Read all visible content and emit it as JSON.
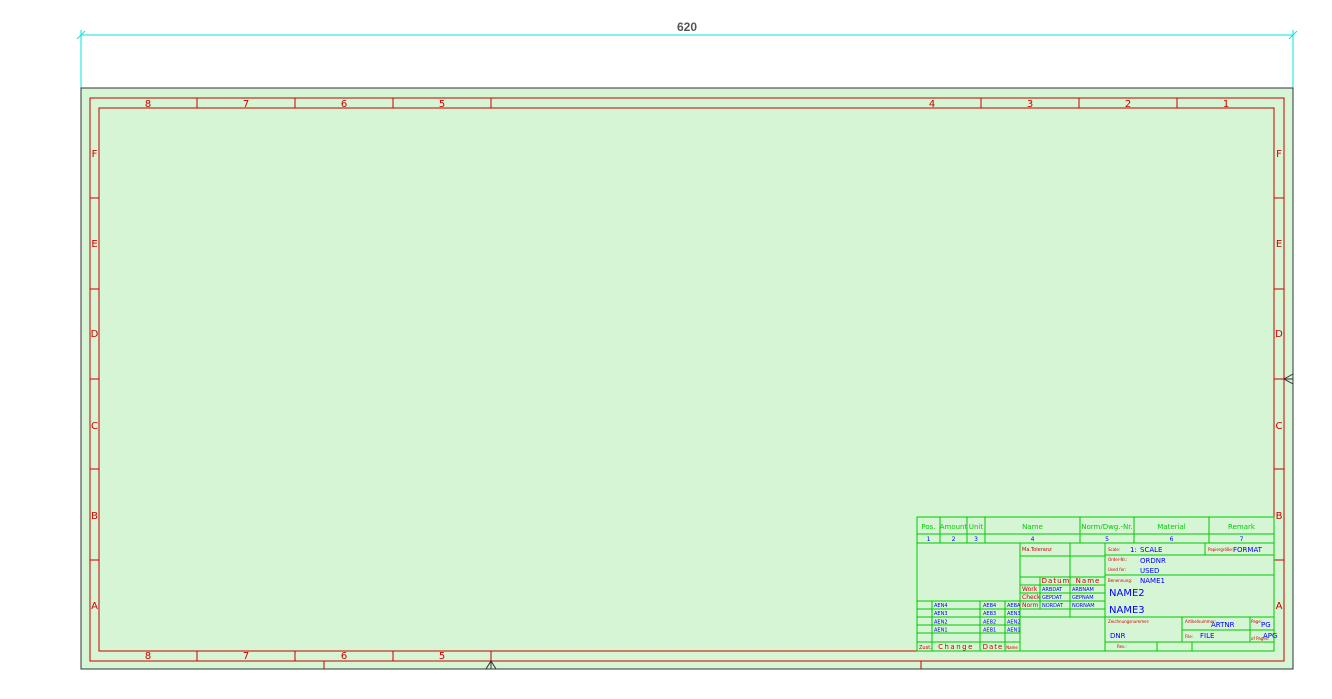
{
  "dimension": {
    "value": "620"
  },
  "colors": {
    "sheet_fill": "#d5f5d5",
    "frame_red": "#cc0000",
    "grid_label_red": "#cc0000",
    "title_green": "#00cc00",
    "value_blue": "#0000ff",
    "dim_cyan": "#00e5e5",
    "dim_text": "#555555"
  },
  "columns_top": [
    "8",
    "7",
    "6",
    "5",
    "4",
    "3",
    "2",
    "1"
  ],
  "columns_bottom": [
    "8",
    "7",
    "6",
    "5"
  ],
  "rows": [
    "F",
    "E",
    "D",
    "C",
    "B",
    "A"
  ],
  "parts_list": {
    "headers": [
      "Pos.",
      "Amount",
      "Unit",
      "Name",
      "Norm/Dwg.-Nr.",
      "Material",
      "Remark"
    ],
    "numbers": [
      "1",
      "2",
      "3",
      "4",
      "5",
      "6",
      "7"
    ]
  },
  "title_block": {
    "ma_label": "Ma.Toleranz",
    "datum_label": "Datum",
    "name_label": "Name",
    "work_label": "Work",
    "check_label": "Check",
    "norm_label": "Norm",
    "work_date": "ARBDAT",
    "work_name": "ARBNAM",
    "check_date": "GEPDAT",
    "check_name": "GEPNAM",
    "norm_date": "NORDAT",
    "norm_name": "NORNAM",
    "revisions": [
      {
        "rev": "AEN4",
        "mid": "AEB4",
        "right": "AEBA"
      },
      {
        "rev": "AEN3",
        "mid": "AEB3",
        "right": "AEN3"
      },
      {
        "rev": "AEN2",
        "mid": "AEB2",
        "right": "AEN2"
      },
      {
        "rev": "AEN1",
        "mid": "AEB1",
        "right": "AEN1"
      }
    ],
    "zust_label": "Zust.",
    "change_label": "Change",
    "date_label": "Date",
    "name_small_label": "Name",
    "scale_label": "Scale:",
    "scale_prefix": "1:",
    "scale_value": "SCALE",
    "format_label": "Papiergröße:",
    "format_value": "FORMAT",
    "order_label": "Order-Nr.:",
    "order_value": "ORDNR",
    "used_label": "Used for:",
    "used_value": "USED",
    "benennung_label": "Benennung:",
    "name1": "NAME1",
    "name2": "NAME2",
    "name3": "NAME3",
    "drawing_label": "Zeichnungsnummer:",
    "drawing_value": "DNR",
    "artnr_label": "Artikelnummer:",
    "artnr_value": "ARTNR",
    "page_label": "Page:",
    "page_value": "PG",
    "file_label": "File:",
    "file_value": "FILE",
    "of_label": "of Pages:",
    "of_value": "APG",
    "rev_label": "Rev.:"
  }
}
